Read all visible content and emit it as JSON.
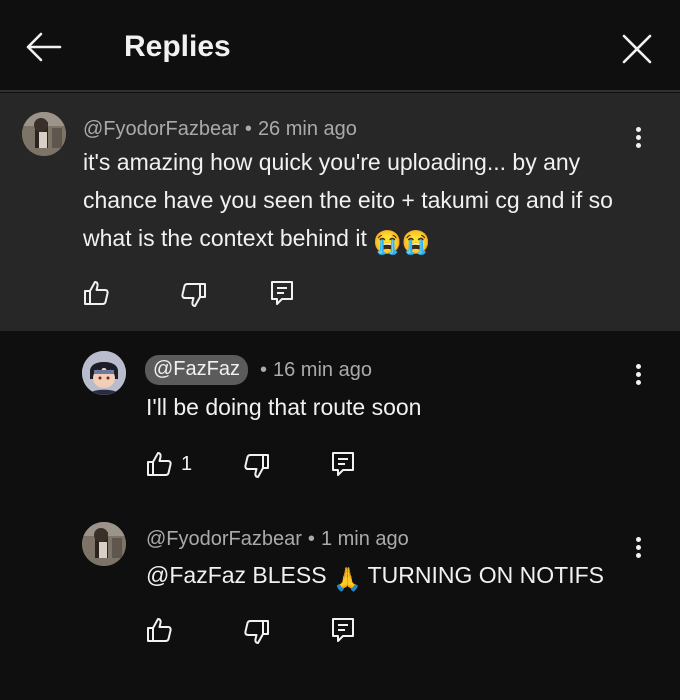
{
  "header": {
    "title": "Replies"
  },
  "parent_comment": {
    "author": "@FyodorFazbear",
    "separator": "•",
    "time": "26 min ago",
    "text": "it's amazing how quick you're uploading... by any chance have you seen the eito + takumi cg and if so what is the context behind it",
    "emoji": "😭😭"
  },
  "replies": [
    {
      "author": "@FazFaz",
      "author_is_creator": true,
      "separator": "•",
      "time": "16 min ago",
      "text": "I'll be doing that route soon",
      "like_count": "1"
    },
    {
      "author": "@FyodorFazbear",
      "author_is_creator": false,
      "separator": "•",
      "time": "1 min ago",
      "text_before_emoji": "@FazFaz BLESS",
      "emoji": "🙏",
      "text_after_emoji": "TURNING ON NOTIFS"
    }
  ],
  "icons": {
    "back": "arrow-left-icon",
    "close": "close-icon",
    "like": "thumbs-up-icon",
    "dislike": "thumbs-down-icon",
    "reply": "reply-icon",
    "more": "more-vertical-icon"
  },
  "colors": {
    "background": "#0f0f0f",
    "parent_background": "#272727",
    "text_primary": "#f1f1f1",
    "text_secondary": "#aaaaaa",
    "creator_pill": "#5b5b5b"
  }
}
